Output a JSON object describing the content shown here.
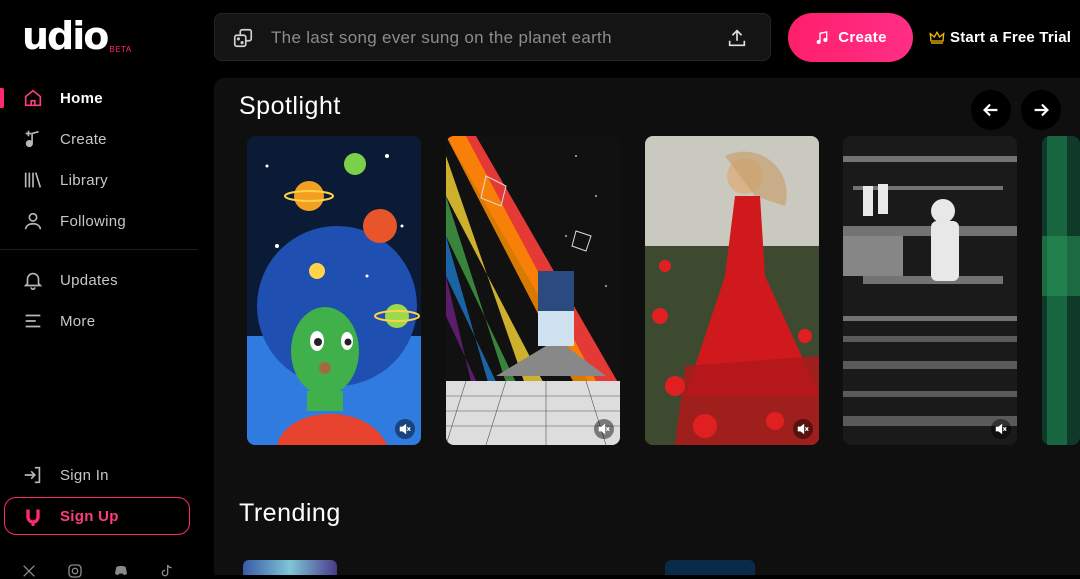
{
  "app": {
    "logo": "udio",
    "badge": "BETA"
  },
  "sidebar": {
    "items": [
      {
        "label": "Home",
        "icon": "home-icon",
        "active": true
      },
      {
        "label": "Create",
        "icon": "music-plus-icon"
      },
      {
        "label": "Library",
        "icon": "library-icon"
      },
      {
        "label": "Following",
        "icon": "user-icon"
      },
      {
        "label": "Updates",
        "icon": "bell-icon"
      },
      {
        "label": "More",
        "icon": "menu-icon"
      }
    ],
    "sign_in": "Sign In",
    "sign_up": "Sign Up",
    "socials": [
      "x-icon",
      "instagram-icon",
      "discord-icon",
      "tiktok-icon"
    ]
  },
  "header": {
    "search_placeholder": "The last song ever sung on the planet earth",
    "create_label": "Create",
    "trial_label": "Start a Free Trial"
  },
  "main": {
    "spotlight_title": "Spotlight",
    "trending_title": "Trending",
    "cards": [
      {
        "name": "spotlight-card-cosmic-girl",
        "muted": true
      },
      {
        "name": "spotlight-card-rainbow-portal",
        "muted": true
      },
      {
        "name": "spotlight-card-red-dress",
        "muted": true
      },
      {
        "name": "spotlight-card-monochrome-motion",
        "muted": true
      }
    ]
  },
  "colors": {
    "accent": "#ff2a6d",
    "background": "#000000",
    "panel": "#0f0f0f",
    "crown": "#f5b800"
  }
}
